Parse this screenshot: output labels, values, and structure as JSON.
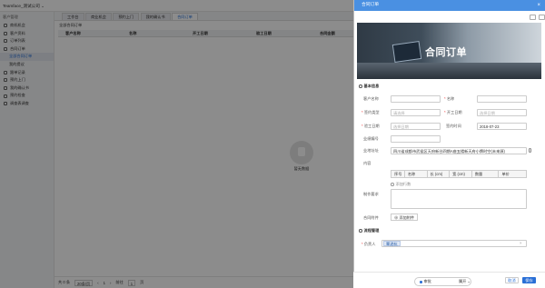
{
  "app": {
    "company": "Teamface_测试公司 ⌄"
  },
  "sidebar": {
    "header": "客户管理",
    "items": [
      {
        "label": "商机机会"
      },
      {
        "label": "客户资料"
      },
      {
        "label": "订单列表"
      },
      {
        "label": "合同订单"
      },
      {
        "label": "全部合同订单"
      },
      {
        "label": "我的提议"
      },
      {
        "label": "跟单记录"
      },
      {
        "label": "预约上门"
      },
      {
        "label": "我的确认书"
      },
      {
        "label": "预约检查"
      },
      {
        "label": "调查表调查"
      }
    ]
  },
  "tabs": [
    {
      "label": "工作台"
    },
    {
      "label": "商业机会"
    },
    {
      "label": "预约上门"
    },
    {
      "label": "我的确认书"
    },
    {
      "label": "合同订单"
    }
  ],
  "breadcrumb": "全部合同订单",
  "grid": {
    "columns": [
      "客户名称",
      "名称",
      "开工日期",
      "验工日期",
      "合同金额"
    ]
  },
  "empty_text": "暂无数据",
  "pager": {
    "total": "共 0 条",
    "page_size": "20条/页",
    "prev": "‹",
    "page": "1",
    "next": "›",
    "goto_label": "前往",
    "goto_value": "1",
    "goto_suffix": "页"
  },
  "panel": {
    "title": "合同订单",
    "close": "×",
    "banner_title": "合同订单",
    "section_basic": "基本信息",
    "section_follow": "流程管理",
    "fields": {
      "customer": {
        "label": "客户名称",
        "placeholder": ""
      },
      "name": {
        "label": "名称",
        "placeholder": ""
      },
      "contract_type": {
        "label": "签约类型",
        "placeholder": "请选择"
      },
      "start_date": {
        "label": "开工日期",
        "placeholder": "选择日期"
      },
      "check_date": {
        "label": "验工日期",
        "placeholder": "选择日期"
      },
      "sign_date": {
        "label": "签约时间",
        "value": "2018-07-23"
      },
      "sales_number": {
        "label": "业绩编号",
        "placeholder": ""
      },
      "address": {
        "label": "业地址址",
        "value": "四川省成都市武侯区天府新谷四期A座五楼新天府小牌时空(未来源)"
      },
      "content": {
        "label": "内容"
      },
      "remarks": {
        "label": "制作要求"
      },
      "attachment": {
        "label": "合同附件",
        "button": "添加附件"
      },
      "owner": {
        "label": "负责人",
        "value": "覃逊杭"
      }
    },
    "table_cols": [
      "序号",
      "名称",
      "长 (cm)",
      "宽 (cm)",
      "数量",
      "单价"
    ],
    "add_row": "添加行数",
    "footer": {
      "approval": "审批",
      "approval_suffix": "属开 ⌄",
      "cancel": "取消",
      "save": "保存"
    }
  }
}
